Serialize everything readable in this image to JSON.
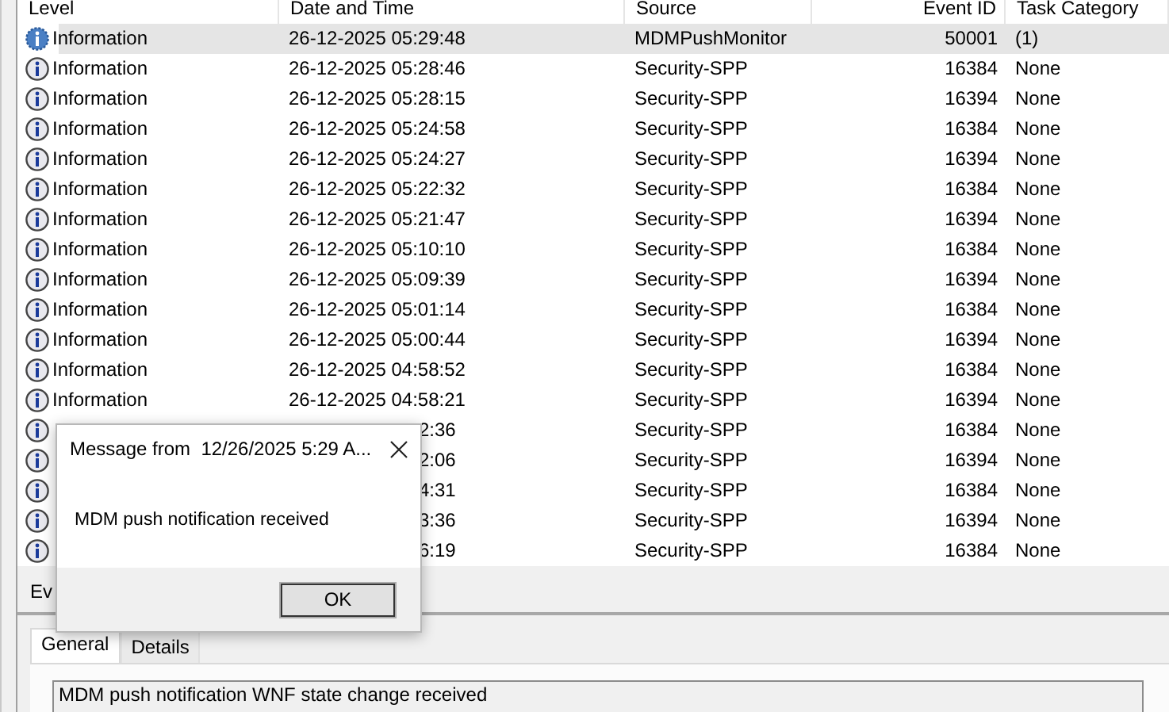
{
  "columns": [
    "Level",
    "Date and Time",
    "Source",
    "Event ID",
    "Task Category"
  ],
  "rows": [
    {
      "level": "Information",
      "date": "26-12-2025 05:29:48",
      "source": "MDMPushMonitor",
      "event_id": "50001",
      "task_category": "(1)",
      "selected": true
    },
    {
      "level": "Information",
      "date": "26-12-2025 05:28:46",
      "source": "Security-SPP",
      "event_id": "16384",
      "task_category": "None",
      "selected": false
    },
    {
      "level": "Information",
      "date": "26-12-2025 05:28:15",
      "source": "Security-SPP",
      "event_id": "16394",
      "task_category": "None",
      "selected": false
    },
    {
      "level": "Information",
      "date": "26-12-2025 05:24:58",
      "source": "Security-SPP",
      "event_id": "16384",
      "task_category": "None",
      "selected": false
    },
    {
      "level": "Information",
      "date": "26-12-2025 05:24:27",
      "source": "Security-SPP",
      "event_id": "16394",
      "task_category": "None",
      "selected": false
    },
    {
      "level": "Information",
      "date": "26-12-2025 05:22:32",
      "source": "Security-SPP",
      "event_id": "16384",
      "task_category": "None",
      "selected": false
    },
    {
      "level": "Information",
      "date": "26-12-2025 05:21:47",
      "source": "Security-SPP",
      "event_id": "16394",
      "task_category": "None",
      "selected": false
    },
    {
      "level": "Information",
      "date": "26-12-2025 05:10:10",
      "source": "Security-SPP",
      "event_id": "16384",
      "task_category": "None",
      "selected": false
    },
    {
      "level": "Information",
      "date": "26-12-2025 05:09:39",
      "source": "Security-SPP",
      "event_id": "16394",
      "task_category": "None",
      "selected": false
    },
    {
      "level": "Information",
      "date": "26-12-2025 05:01:14",
      "source": "Security-SPP",
      "event_id": "16384",
      "task_category": "None",
      "selected": false
    },
    {
      "level": "Information",
      "date": "26-12-2025 05:00:44",
      "source": "Security-SPP",
      "event_id": "16394",
      "task_category": "None",
      "selected": false
    },
    {
      "level": "Information",
      "date": "26-12-2025 04:58:52",
      "source": "Security-SPP",
      "event_id": "16384",
      "task_category": "None",
      "selected": false
    },
    {
      "level": "Information",
      "date": "26-12-2025 04:58:21",
      "source": "Security-SPP",
      "event_id": "16394",
      "task_category": "None",
      "selected": false
    },
    {
      "covered": true,
      "date": "2:36",
      "source": "Security-SPP",
      "event_id": "16384",
      "task_category": "None",
      "selected": false
    },
    {
      "covered": true,
      "date": "2:06",
      "source": "Security-SPP",
      "event_id": "16394",
      "task_category": "None",
      "selected": false
    },
    {
      "covered": true,
      "date": "4:31",
      "source": "Security-SPP",
      "event_id": "16384",
      "task_category": "None",
      "selected": false
    },
    {
      "covered": true,
      "date": "3:36",
      "source": "Security-SPP",
      "event_id": "16394",
      "task_category": "None",
      "selected": false
    },
    {
      "covered": true,
      "date": "6:19",
      "source": "Security-SPP",
      "event_id": "16384",
      "task_category": "None",
      "selected": false
    }
  ],
  "details_panel": {
    "header": "Ev",
    "tabs": [
      {
        "label": "General",
        "selected": true
      },
      {
        "label": "Details",
        "selected": false
      }
    ],
    "description": "MDM push notification WNF state change received"
  },
  "dialog": {
    "title": "Message from  12/26/2025 5:29 A...",
    "message": "MDM push notification received",
    "buttons": [
      "OK"
    ]
  }
}
